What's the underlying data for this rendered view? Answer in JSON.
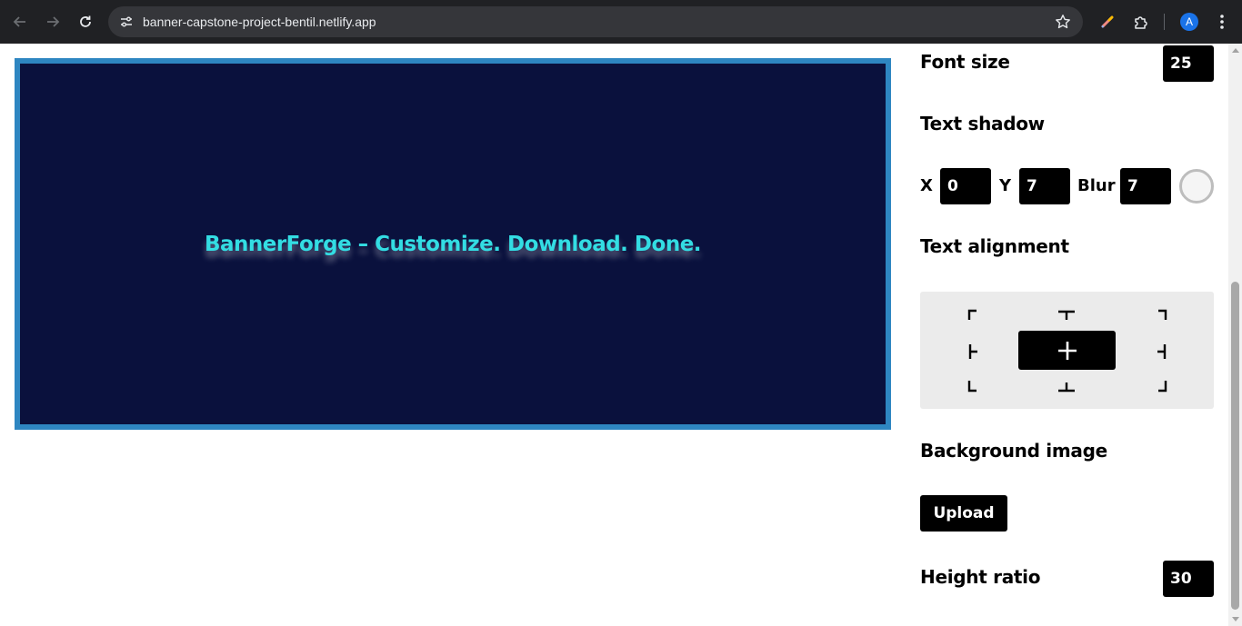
{
  "browser": {
    "url": "banner-capstone-project-bentil.netlify.app",
    "avatar_initial": "A",
    "icons": [
      "back-icon",
      "forward-icon",
      "reload-icon",
      "site-info-icon",
      "star-icon",
      "pen-extension-icon",
      "puzzle-icon",
      "kebab-menu-icon"
    ]
  },
  "banner": {
    "text": "BannerForge – Customize. Download. Done.",
    "background_color": "#0a113d",
    "border_color": "#2e86c1",
    "text_color": "#33dde3"
  },
  "panel": {
    "font_size_label": "Font size",
    "font_size_value": "25",
    "text_shadow_label": "Text shadow",
    "shadow_x_label": "X",
    "shadow_x_value": "0",
    "shadow_y_label": "Y",
    "shadow_y_value": "7",
    "shadow_blur_label": "Blur",
    "shadow_blur_value": "7",
    "text_alignment_label": "Text alignment",
    "background_image_label": "Background image",
    "upload_label": "Upload",
    "height_ratio_label": "Height ratio",
    "height_ratio_value": "30"
  }
}
